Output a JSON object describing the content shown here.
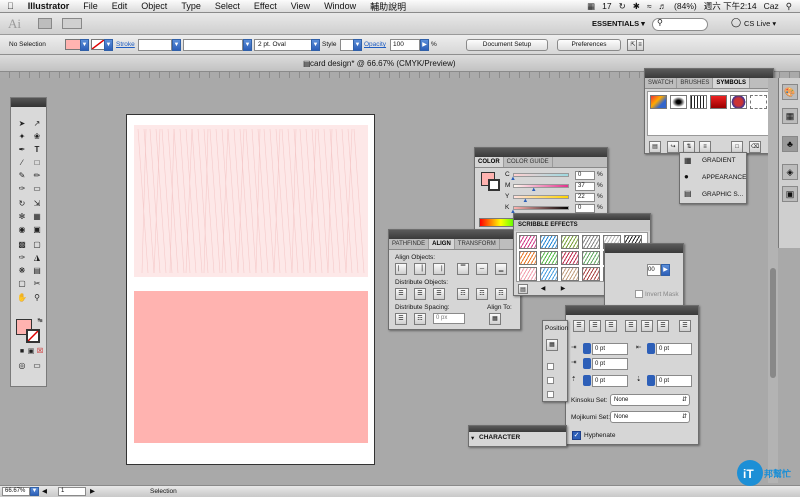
{
  "menubar": {
    "app": "Illustrator",
    "items": [
      "File",
      "Edit",
      "Object",
      "Type",
      "Select",
      "Effect",
      "View",
      "Window",
      "輔助說明"
    ],
    "status": {
      "adobe_count": "17",
      "battery": "(84%)",
      "clock": "週六 下午2:14",
      "user": "Caz"
    }
  },
  "appbar": {
    "workspace": "ESSENTIALS ▾",
    "cslive": "CS Live ▾",
    "ai": "Ai"
  },
  "controlbar": {
    "selection": "No Selection",
    "stroke_label": "Stroke",
    "brush_value": "2 pt. Oval",
    "style_label": "Style",
    "opacity_label": "Opacity",
    "opacity_value": "100",
    "percent": "%",
    "doc_setup": "Document Setup",
    "preferences": "Preferences"
  },
  "document": {
    "title": "card design* @ 66.67% (CMYK/Preview)"
  },
  "color_panel": {
    "tabs": [
      "COLOR",
      "COLOR GUIDE"
    ],
    "channels": [
      {
        "name": "C",
        "value": "0",
        "fraction": 0.0
      },
      {
        "name": "M",
        "value": "37",
        "fraction": 0.37
      },
      {
        "name": "Y",
        "value": "22",
        "fraction": 0.22
      },
      {
        "name": "K",
        "value": "0",
        "fraction": 0.0
      }
    ],
    "unit": "%"
  },
  "swatch_panel": {
    "tabs": [
      "SWATCH",
      "BRUSHES",
      "SYMBOLS"
    ]
  },
  "dock_labels": {
    "gradient": "GRADIENT",
    "appearance": "APPEARANCE",
    "graphic": "GRAPHIC S..."
  },
  "align_panel": {
    "tabs": [
      "PATHFINDE",
      "ALIGN",
      "TRANSFORM"
    ],
    "align_objects": "Align Objects:",
    "distribute_objects": "Distribute Objects:",
    "distribute_spacing": "Distribute Spacing:",
    "align_to": "Align To:",
    "spacing_value": "0 px"
  },
  "scribble_panel": {
    "title": "SCRIBBLE EFFECTS"
  },
  "transparency_partial": {
    "value": "00",
    "invert": "Invert Mask"
  },
  "paragraph_panel": {
    "position_label": "Position",
    "fields": [
      "0 pt",
      "0 pt",
      "0 pt",
      "0 pt",
      "0 pt",
      "0 pt",
      "0 pt"
    ],
    "kinsoku_label": "Kinsoku Set:",
    "kinsoku_value": "None",
    "mojikumi_label": "Mojikumi Set:",
    "mojikumi_value": "None",
    "hyphenate": "Hyphenate"
  },
  "character_panel": {
    "title": "CHARACTER"
  },
  "statusbar": {
    "zoom": "66.67%",
    "page": "1",
    "mode": "Selection"
  },
  "colors": {
    "fill": "#ffb3b0",
    "accent": "#2d5fb8"
  },
  "watermark": {
    "text": "iT邦幫忙"
  }
}
